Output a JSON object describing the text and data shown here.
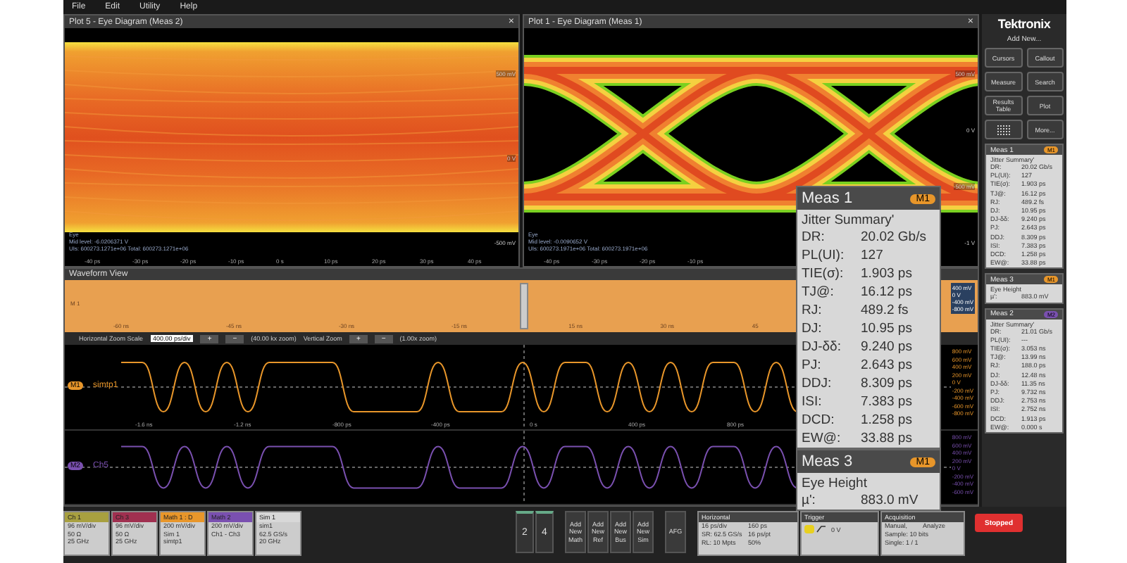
{
  "menu": [
    "File",
    "Edit",
    "Utility",
    "Help"
  ],
  "plots": [
    {
      "title": "Plot 5 - Eye Diagram (Meas 2)",
      "close": "×",
      "kind": "closed",
      "y_labels": [
        "500 mV",
        "0 V",
        "-500 mV"
      ],
      "x_labels": [
        "-40 ps",
        "-30 ps",
        "-20 ps",
        "-10 ps",
        "0 s",
        "10 ps",
        "20 ps",
        "30 ps",
        "40 ps"
      ],
      "info": [
        "Eye",
        "Mid level: -6.0206371 V",
        "UIs: 600273.1271e+06  Total: 600273.1271e+06"
      ]
    },
    {
      "title": "Plot 1 - Eye Diagram (Meas 1)",
      "close": "×",
      "kind": "open",
      "y_labels": [
        "500 mV",
        "0 V",
        "-500 mV",
        "-1 V"
      ],
      "x_labels": [
        "-40 ps",
        "-30 ps",
        "-20 ps",
        "-10 ps"
      ],
      "info": [
        "Eye",
        "Mid level: -0.0090652 V",
        "UIs: 600273.1971e+06  Total: 600273.1971e+06"
      ]
    }
  ],
  "waveform_view": {
    "title": "Waveform View",
    "overview_label": "M 1",
    "overview_ticks_before": [
      "-60 ns",
      "-45 ns",
      "-30 ns",
      "-15 ns"
    ],
    "overview_ticks_after": [
      "15 ns",
      "30 ns",
      "45"
    ],
    "overview_y": [
      "400 mV",
      "0 V",
      "-400 mV",
      "-800 mV"
    ],
    "zoom": {
      "h_label": "Horizontal Zoom Scale",
      "h_value": "400.00 ps/div",
      "plus": "+",
      "minus": "−",
      "h_factor": "(40.00 kx zoom)",
      "v_label": "Vertical Zoom",
      "v_factor": "(1.00x zoom)"
    },
    "traces": [
      {
        "badge": "M1",
        "name": "simtp1",
        "color": "#e8962a",
        "ticks": [
          "-1.6 ns",
          "-1.2 ns",
          "-800 ps",
          "-400 ps",
          "0 s",
          "400 ps",
          "800 ps"
        ],
        "y_labels": [
          "800 mV",
          "600 mV",
          "400 mV",
          "200 mV",
          "0 V",
          "-200 mV",
          "-400 mV",
          "-600 mV",
          "-800 mV"
        ]
      },
      {
        "badge": "M2",
        "name": "Ch5",
        "color": "#7a50b0",
        "y_labels": [
          "800 mV",
          "600 mV",
          "400 mV",
          "200 mV",
          "0 V",
          "-200 mV",
          "-400 mV",
          "-600 mV"
        ]
      }
    ]
  },
  "popups": [
    {
      "title": "Meas 1",
      "badge": "M1",
      "color": "#e8962a",
      "heading": "Jitter Summary'",
      "rows": [
        {
          "label": "DR:",
          "value": "20.02 Gb/s"
        },
        {
          "label": "PL(UI):",
          "value": "127"
        },
        {
          "label": "TIE(σ):",
          "value": "1.903 ps"
        },
        {
          "label": "TJ@:",
          "value": "16.12 ps"
        },
        {
          "label": "RJ:",
          "value": "489.2 fs"
        },
        {
          "label": "DJ:",
          "value": "10.95 ps"
        },
        {
          "label": "DJ-δδ:",
          "value": "9.240 ps"
        },
        {
          "label": "PJ:",
          "value": "2.643 ps"
        },
        {
          "label": "DDJ:",
          "value": "8.309 ps"
        },
        {
          "label": "ISI:",
          "value": "7.383 ps"
        },
        {
          "label": "DCD:",
          "value": "1.258 ps"
        },
        {
          "label": "EW@:",
          "value": "33.88 ps"
        }
      ]
    },
    {
      "title": "Meas 3",
      "badge": "M1",
      "color": "#e8962a",
      "heading": "Eye Height",
      "rows": [
        {
          "label": "µ':",
          "value": "883.0 mV"
        }
      ]
    }
  ],
  "side_panel": {
    "logo": "Tektronix",
    "add_new": "Add New...",
    "buttons": [
      "Cursors",
      "Callout",
      "Measure",
      "Search",
      "Results Table",
      "Plot"
    ],
    "more": "More...",
    "cards": [
      {
        "title": "Meas 1",
        "badge": "M1",
        "color": "#e8962a",
        "heading": "Jitter Summary'",
        "rows": [
          {
            "label": "DR:",
            "value": "20.02 Gb/s"
          },
          {
            "label": "PL(UI):",
            "value": "127"
          },
          {
            "label": "TIE(σ):",
            "value": "1.903 ps"
          },
          {
            "label": "TJ@:",
            "value": "16.12 ps"
          },
          {
            "label": "RJ:",
            "value": "489.2 fs"
          },
          {
            "label": "DJ:",
            "value": "10.95 ps"
          },
          {
            "label": "DJ-δδ:",
            "value": "9.240 ps"
          },
          {
            "label": "PJ:",
            "value": "2.643 ps"
          },
          {
            "label": "DDJ:",
            "value": "8.309 ps"
          },
          {
            "label": "ISI:",
            "value": "7.383 ps"
          },
          {
            "label": "DCD:",
            "value": "1.258 ps"
          },
          {
            "label": "EW@:",
            "value": "33.88 ps"
          }
        ]
      },
      {
        "title": "Meas 3",
        "badge": "M1",
        "color": "#e8962a",
        "heading": "Eye Height",
        "rows": [
          {
            "label": "µ':",
            "value": "883.0 mV"
          }
        ]
      },
      {
        "title": "Meas 2",
        "badge": "M2",
        "color": "#7a50b0",
        "heading": "Jitter Summary'",
        "rows": [
          {
            "label": "DR:",
            "value": "21.01 Gb/s"
          },
          {
            "label": "PL(UI):",
            "value": "---"
          },
          {
            "label": "TIE(σ):",
            "value": "3.053 ns"
          },
          {
            "label": "TJ@:",
            "value": "13.99 ns"
          },
          {
            "label": "RJ:",
            "value": "188.0 ps"
          },
          {
            "label": "DJ:",
            "value": "12.48 ns"
          },
          {
            "label": "DJ-δδ:",
            "value": "11.35 ns"
          },
          {
            "label": "PJ:",
            "value": "9.732 ns"
          },
          {
            "label": "DDJ:",
            "value": "2.753 ns"
          },
          {
            "label": "ISI:",
            "value": "2.752 ns"
          },
          {
            "label": "DCD:",
            "value": "1.913 ps"
          },
          {
            "label": "EW@:",
            "value": "0.000 s"
          }
        ]
      }
    ]
  },
  "bottom_bar": {
    "channels": [
      {
        "title": "Ch 1",
        "color": "#a8a040",
        "lines": [
          "96 mV/div",
          "50 Ω",
          "25 GHz"
        ]
      },
      {
        "title": "Ch 3",
        "color": "#a03050",
        "lines": [
          "96 mV/div",
          "50 Ω",
          "25 GHz"
        ]
      },
      {
        "title": "Math 1 : D",
        "color": "#e8962a",
        "lines": [
          "200 mV/div",
          "Sim 1",
          "simtp1"
        ]
      },
      {
        "title": "Math 2",
        "color": "#7a50b0",
        "lines": [
          "200 mV/div",
          "Ch1 - Ch3"
        ]
      },
      {
        "title": "Sim 1",
        "color": "#d8d8d8",
        "lines": [
          "sim1",
          "62.5 GS/s",
          "20 GHz"
        ]
      }
    ],
    "numbers": [
      "2",
      "4"
    ],
    "add_buttons": [
      "Add New Math",
      "Add New Ref",
      "Add New Bus",
      "Add New Sim"
    ],
    "afg": "AFG",
    "horizontal": {
      "title": "Horizontal",
      "cells": [
        "16 ps/div",
        "160 ps",
        "SR: 62.5 GS/s",
        "16 ps/pt",
        "RL: 10 Mpts",
        "50%"
      ]
    },
    "trigger": {
      "title": "Trigger",
      "level": "0 V"
    },
    "acquisition": {
      "title": "Acquisition",
      "cells": [
        "Manual,",
        "Analyze",
        "Sample: 10 bits",
        "Single: 1 / 1"
      ]
    },
    "run_state": "Stopped"
  }
}
